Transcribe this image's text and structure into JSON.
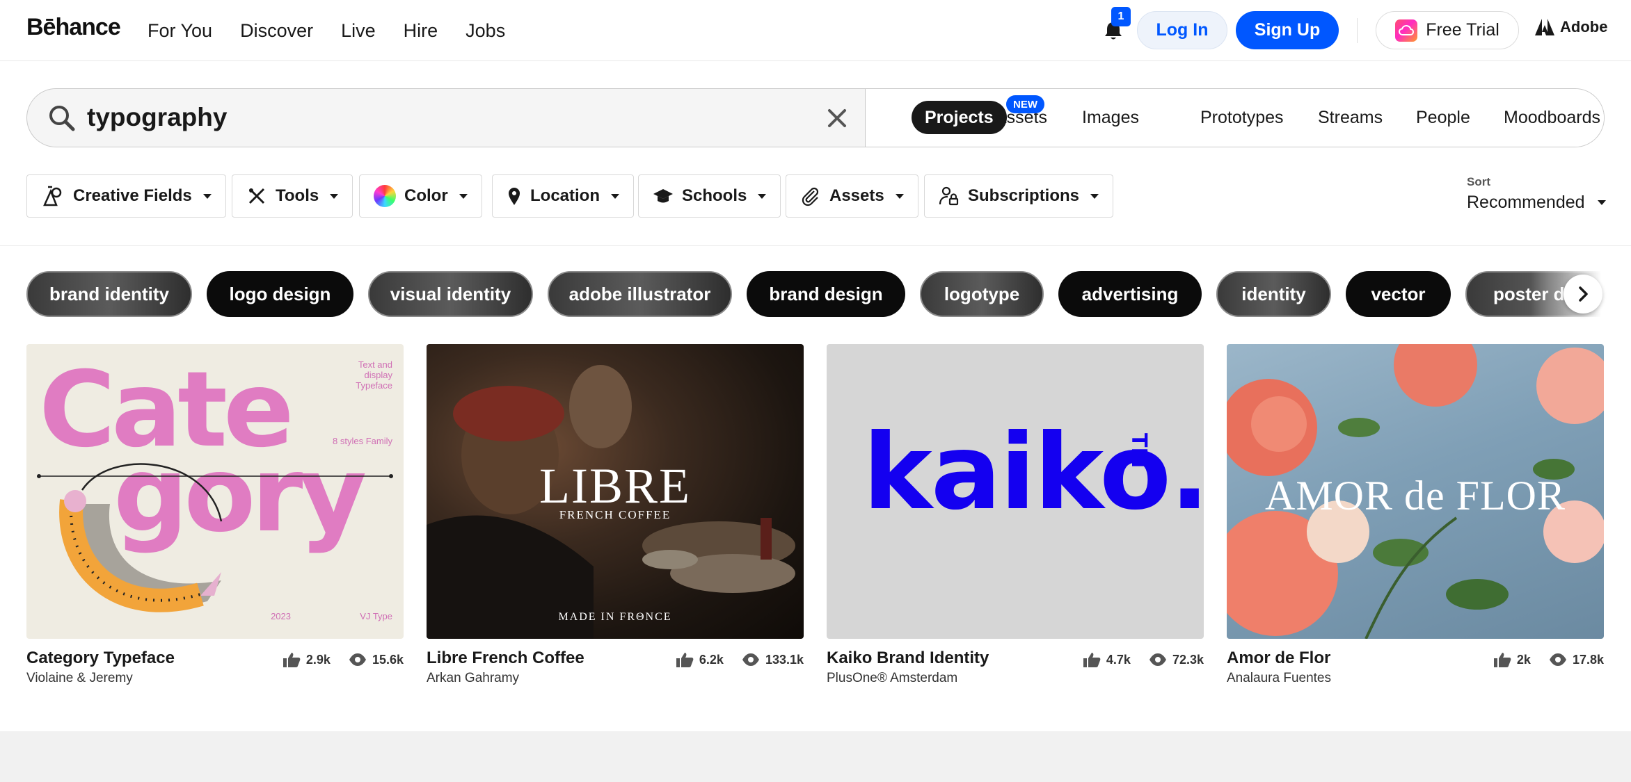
{
  "nav": {
    "logo": "Bēhance",
    "links": [
      "For You",
      "Discover",
      "Live",
      "Hire",
      "Jobs"
    ],
    "notification_count": "1",
    "login": "Log In",
    "signup": "Sign Up",
    "free_trial": "Free Trial",
    "adobe": "Adobe",
    "accent_color": "#0057ff"
  },
  "search": {
    "value": "typography",
    "tabs": [
      "Projects",
      "Assets",
      "Images",
      "Prototypes",
      "Streams",
      "People",
      "Moodboards"
    ],
    "active_tab": "Projects",
    "new_badge": "NEW"
  },
  "filters": {
    "items": [
      "Creative Fields",
      "Tools",
      "Color",
      "Location",
      "Schools",
      "Assets",
      "Subscriptions"
    ],
    "sort_label": "Sort",
    "sort_value": "Recommended"
  },
  "tags": [
    "brand identity",
    "logo design",
    "visual identity",
    "adobe illustrator",
    "brand design",
    "logotype",
    "advertising",
    "identity",
    "vector",
    "poster de"
  ],
  "projects": [
    {
      "title": "Category Typeface",
      "owner": "Violaine & Jeremy",
      "likes": "2.9k",
      "views": "15.6k",
      "thumb": {
        "word_top": "Cate",
        "word_bottom": "gory",
        "note1": "Text and display Typeface",
        "note2": "8 styles Family",
        "year": "2023",
        "brand": "VJ Type"
      }
    },
    {
      "title": "Libre French Coffee",
      "owner": "Arkan Gahramy",
      "likes": "6.2k",
      "views": "133.1k",
      "thumb": {
        "title": "LIBRE",
        "sub": "FRENCH COFFEE",
        "foot": "MADE IN FRΘNCE"
      }
    },
    {
      "title": "Kaiko Brand Identity",
      "owner": "PlusOne® Amsterdam",
      "likes": "4.7k",
      "views": "72.3k",
      "thumb": {
        "word": "kaiko.",
        "tm": "TM"
      }
    },
    {
      "title": "Amor de Flor",
      "owner": "Analaura Fuentes",
      "likes": "2k",
      "views": "17.8k",
      "thumb": {
        "title": "AMOR de FLOR"
      }
    }
  ]
}
